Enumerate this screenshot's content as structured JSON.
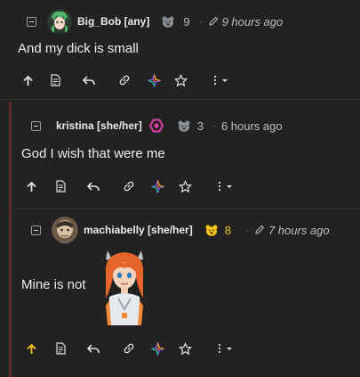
{
  "comments": [
    {
      "username": "Big_Bob [any]",
      "score": "9",
      "time": "9 hours ago",
      "text": "And my dick is small",
      "avatar": "green-haired-anime-girl-avatar",
      "score_badge": "gray-bear-icon",
      "edited": true
    },
    {
      "username": "kristina [she/her]",
      "score": "3",
      "time": "6 hours ago",
      "text": "God I wish that were me",
      "flair": "pink-hexagon-icon",
      "score_badge": "gray-bear-icon",
      "edited": false
    },
    {
      "username": "machiabelly [she/her]",
      "score": "8",
      "time": "7 hours ago",
      "text": "Mine is not",
      "avatar": "round-avatar",
      "score_badge": "gold-bear-icon",
      "edited": true,
      "attached_image": "orange-haired-anime-girl-emoji"
    }
  ],
  "colors": {
    "background": "#222222",
    "thread_line": "#5a2a2a",
    "upvoted": "#f5c518",
    "score_gold": "#f5c518",
    "flair_pink": "#e040a0"
  },
  "actions": [
    "upvote",
    "view-source",
    "reply",
    "link",
    "cross-post",
    "save",
    "more"
  ]
}
